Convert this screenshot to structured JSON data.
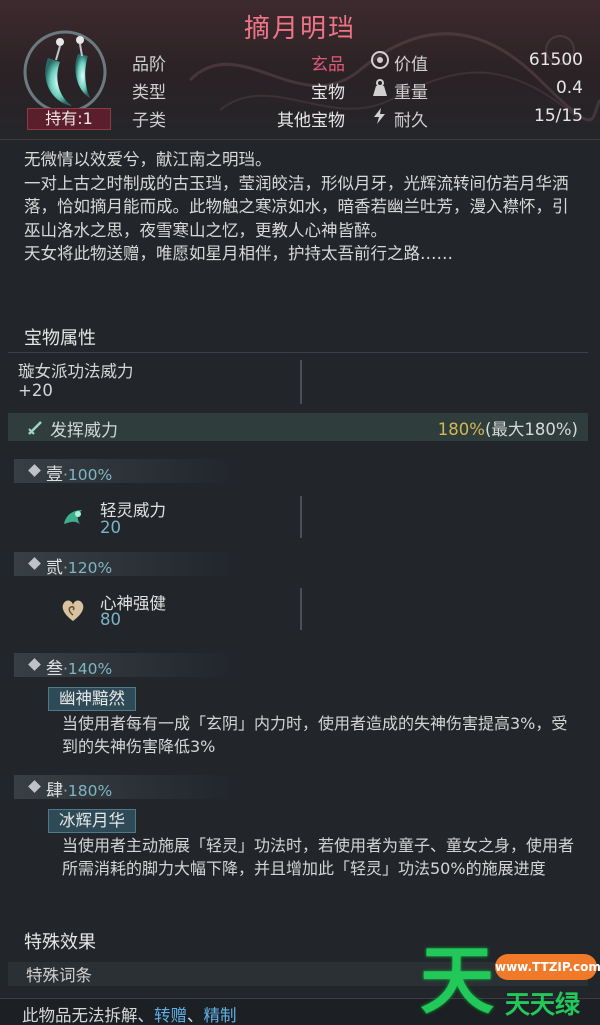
{
  "item": {
    "title": "摘月明珰",
    "owned": "持有:1"
  },
  "stats": {
    "grade_label": "品阶",
    "grade_value": "玄品",
    "type_label": "类型",
    "type_value": "宝物",
    "subtype_label": "子类",
    "subtype_value": "其他宝物",
    "price_label": "价值",
    "price_value": "61500",
    "weight_label": "重量",
    "weight_value": "0.4",
    "durability_label": "耐久",
    "durability_value": "15/15"
  },
  "description": [
    "无微情以效爱兮，献江南之明珰。",
    "一对上古之时制成的古玉珰，莹润皎洁，形似月牙，光辉流转间仿若月华洒落，恰如摘月能而成。此物触之寒凉如水，暗香若幽兰吐芳，漫入襟怀，引巫山洛水之思，夜雪寒山之忆，更教人心神皆醉。",
    "天女将此物送赠，唯愿如星月相伴，护持太吾前行之路……"
  ],
  "treasure_props": {
    "title": "宝物属性",
    "prop_label": "璇女派功法威力",
    "prop_value": "+20",
    "power_label": "发挥威力",
    "power_current": "180%",
    "power_max": "(最大180%)"
  },
  "tiers": [
    {
      "name": "壹",
      "pct": "·100%",
      "attr_name": "轻灵威力",
      "attr_value": "20"
    },
    {
      "name": "贰",
      "pct": "·120%",
      "attr_name": "心神强健",
      "attr_value": "80"
    },
    {
      "name": "叁",
      "pct": "·140%",
      "skill_name": "幽神黯然",
      "skill_desc": "当使用者每有一成「玄阴」内力时，使用者造成的失神伤害提高3%，受到的失神伤害降低3%"
    },
    {
      "name": "肆",
      "pct": "·180%",
      "skill_name": "冰辉月华",
      "skill_desc": "当使用者主动施展「轻灵」功法时，若使用者为童子、童女之身，使用者所需消耗的脚力大幅下降，并且增加此「轻灵」功法50%的施展进度"
    }
  ],
  "special": {
    "title": "特殊效果",
    "entry_label": "特殊词条"
  },
  "footer": {
    "prefix": "此物品无法拆解、",
    "link1": "转赠",
    "sep": "、",
    "link2": "精制"
  },
  "watermark": {
    "big": "天",
    "small": "天天绿软",
    "url": "www.TTZIP.com"
  },
  "colors": {
    "title": "#f07486",
    "grade": "#e05a78",
    "power_current": "#d2b757",
    "tier_pct": "#7fb6c4",
    "link": "#5fb0e6",
    "watermark": "#22c95a"
  }
}
